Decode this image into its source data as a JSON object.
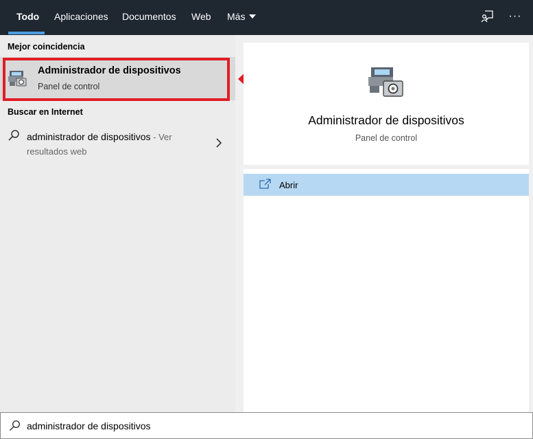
{
  "tabs": [
    {
      "label": "Todo",
      "active": true
    },
    {
      "label": "Aplicaciones"
    },
    {
      "label": "Documentos"
    },
    {
      "label": "Web"
    },
    {
      "label": "Más"
    }
  ],
  "top_icons": {
    "feedback": "feedback-icon",
    "more": "···"
  },
  "left": {
    "best_match_heading": "Mejor coincidencia",
    "best_match": {
      "title": "Administrador de dispositivos",
      "subtitle": "Panel de control",
      "icon": "device-manager-icon"
    },
    "web_heading": "Buscar en Internet",
    "web_result": {
      "query": "administrador de dispositivos",
      "suffix": " - Ver",
      "line2": "resultados web"
    }
  },
  "right": {
    "title": "Administrador de dispositivos",
    "subtitle": "Panel de control",
    "actions": [
      {
        "label": "Abrir",
        "icon": "open-icon"
      }
    ]
  },
  "search": {
    "value": "administrador de dispositivos"
  },
  "colors": {
    "topbar": "#1f2731",
    "accent": "#4a9de0",
    "highlight": "#e01e26",
    "selected_action": "#b7d8f2"
  }
}
